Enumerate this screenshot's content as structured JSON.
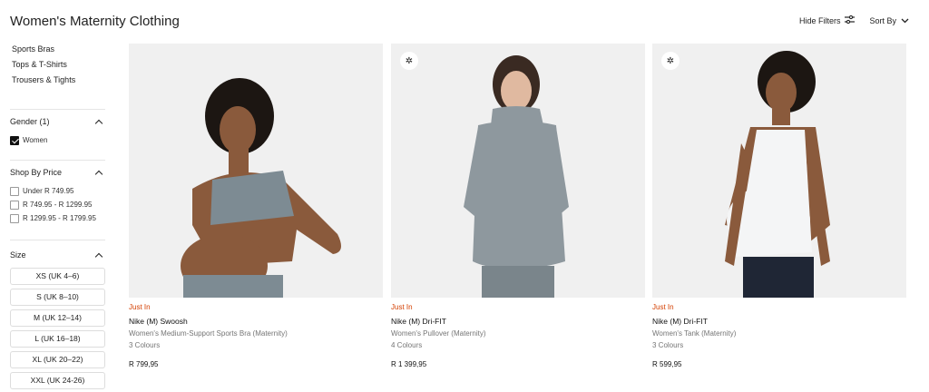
{
  "header": {
    "title": "Women's Maternity Clothing",
    "hide_filters": "Hide Filters",
    "sort_by": "Sort By"
  },
  "sidebar": {
    "categories": [
      "Sports Bras",
      "Tops & T-Shirts",
      "Trousers & Tights"
    ],
    "gender": {
      "title": "Gender (1)",
      "options": [
        {
          "label": "Women",
          "checked": true
        }
      ]
    },
    "price": {
      "title": "Shop By Price",
      "options": [
        {
          "label": "Under R 749.95",
          "checked": false
        },
        {
          "label": "R 749.95 - R 1299.95",
          "checked": false
        },
        {
          "label": "R 1299.95 - R 1799.95",
          "checked": false
        }
      ]
    },
    "size": {
      "title": "Size",
      "options": [
        "XS (UK 4–6)",
        "S (UK 8–10)",
        "M (UK 12–14)",
        "L (UK 16–18)",
        "XL (UK 20–22)",
        "XXL (UK 24-26)"
      ]
    }
  },
  "products": [
    {
      "status": "Just In",
      "name": "Nike (M) Swoosh",
      "subtitle": "Women's Medium-Support Sports Bra (Maternity)",
      "colours": "3 Colours",
      "price": "R 799,95",
      "badge": false,
      "garment_color": "#7d8b93"
    },
    {
      "status": "Just In",
      "name": "Nike (M) Dri-FIT",
      "subtitle": "Women's Pullover (Maternity)",
      "colours": "4 Colours",
      "price": "R 1 399,95",
      "badge": true,
      "garment_color": "#8e989e"
    },
    {
      "status": "Just In",
      "name": "Nike (M) Dri-FIT",
      "subtitle": "Women's Tank (Maternity)",
      "colours": "3 Colours",
      "price": "R 599,95",
      "badge": true,
      "garment_color": "#f4f5f6"
    }
  ],
  "colors": {
    "just_in": "#d43f00",
    "image_bg": "#f5f5f5"
  },
  "icons": {
    "filter": "sliders-icon",
    "sort": "chevron-down-icon",
    "badge": "sustainable-icon"
  }
}
